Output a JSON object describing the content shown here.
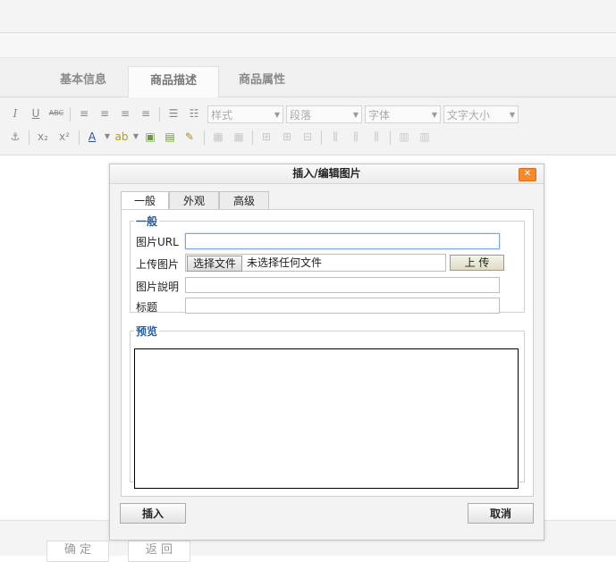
{
  "tabs": [
    "基本信息",
    "商品描述",
    "商品属性"
  ],
  "toolbar": {
    "format_selects": [
      "样式",
      "段落",
      "字体",
      "文字大小"
    ],
    "icons_row1": [
      "italic-icon",
      "underline-icon",
      "strikethrough-icon",
      "align-left-icon",
      "align-center-icon",
      "align-right-icon",
      "align-justify-icon",
      "bullet-list-icon",
      "numbered-list-icon"
    ],
    "icons_row2": [
      "anchor-icon",
      "subscript-icon",
      "superscript-icon",
      "text-color-icon",
      "highlight-color-icon",
      "insert-image-icon",
      "insert-media-icon",
      "edit-icon",
      "table-icons"
    ]
  },
  "dialog": {
    "title": "插入/编辑图片",
    "close": "✕",
    "tabs": [
      "一般",
      "外观",
      "高级"
    ],
    "general": {
      "legend": "一般",
      "url_label": "图片URL",
      "url_value": "",
      "upload_label": "上传图片",
      "choose_file": "选择文件",
      "no_file": "未选择任何文件",
      "upload_button": "上 传",
      "desc_label": "图片說明",
      "title_label": "标题"
    },
    "preview_legend": "预览",
    "insert_button": "插入",
    "cancel_button": "取消"
  },
  "bottom": {
    "confirm": "确 定",
    "back": "返 回"
  }
}
